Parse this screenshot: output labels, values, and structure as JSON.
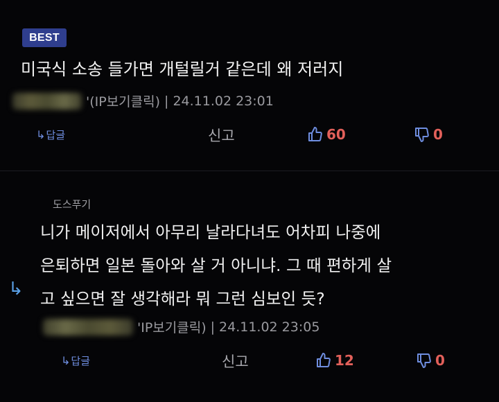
{
  "post": {
    "badge": "BEST",
    "title": "미국식 소송 들가면 개털릴거 같은데 왜 저러지",
    "meta_suffix": "'(IP보기클릭)",
    "separator": "|",
    "timestamp": "24.11.02 23:01",
    "reply_label": "답글",
    "report_label": "신고",
    "upvotes": "60",
    "downvotes": "0"
  },
  "comment": {
    "nickname": "도스푸기",
    "body_lines": [
      "니가 메이저에서 아무리 날라다녀도 어차피 나중에",
      "은퇴하면 일본 돌아와 살 거 아니냐. 그 때 편하게 살",
      "고 싶으면 잘 생각해라 뭐 그런 심보인 듯?"
    ],
    "meta_suffix": "'IP보기클릭)",
    "separator": "|",
    "timestamp": "24.11.02 23:05",
    "reply_label": "답글",
    "report_label": "신고",
    "upvotes": "12",
    "downvotes": "0"
  },
  "colors": {
    "background": "#050507",
    "badge": "#2f3e8e",
    "vote": "#e2605a",
    "link": "#6f8ee0"
  }
}
